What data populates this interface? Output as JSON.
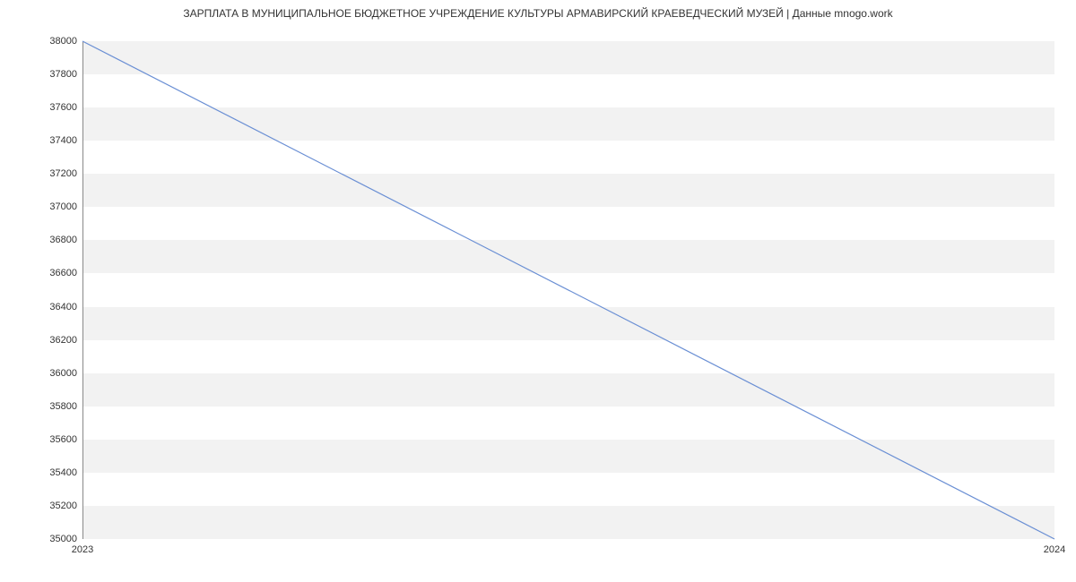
{
  "chart_data": {
    "type": "line",
    "title": "ЗАРПЛАТА В МУНИЦИПАЛЬНОЕ БЮДЖЕТНОЕ УЧРЕЖДЕНИЕ КУЛЬТУРЫ АРМАВИРСКИЙ КРАЕВЕДЧЕСКИЙ МУЗЕЙ | Данные mnogo.work",
    "xlabel": "",
    "ylabel": "",
    "x": [
      2023,
      2024
    ],
    "values": [
      38000,
      35000
    ],
    "ylim": [
      35000,
      38000
    ],
    "xlim": [
      2023,
      2024
    ],
    "y_ticks": [
      35000,
      35200,
      35400,
      35600,
      35800,
      36000,
      36200,
      36400,
      36600,
      36800,
      37000,
      37200,
      37400,
      37600,
      37800,
      38000
    ],
    "x_ticks": [
      2023,
      2024
    ],
    "line_color": "#6a8fd4"
  }
}
